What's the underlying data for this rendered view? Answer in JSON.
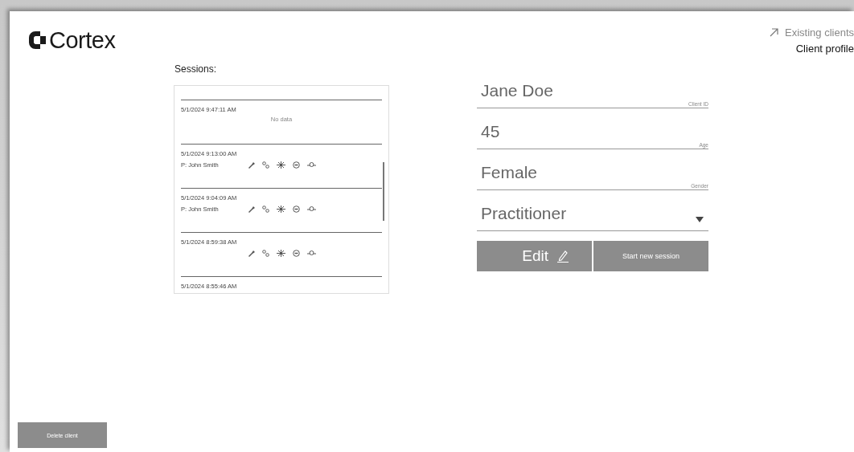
{
  "brand": {
    "name": "Cortex"
  },
  "nav": [
    {
      "label": "Existing clients",
      "selected": false
    },
    {
      "label": "Client profile",
      "selected": true
    }
  ],
  "sessions": {
    "title": "Sessions:",
    "items": [
      {
        "date": "5/1/2024 9:47:11 AM",
        "note": "No data",
        "has_metrics": false
      },
      {
        "date": "5/1/2024 9:13:00 AM",
        "practitioner": "P: John Smith",
        "has_metrics": true
      },
      {
        "date": "5/1/2024 9:04:09 AM",
        "practitioner": "P: John Smith",
        "has_metrics": true
      },
      {
        "date": "5/1/2024 8:59:38 AM",
        "has_metrics": true
      },
      {
        "date": "5/1/2024 8:55:46 AM"
      }
    ]
  },
  "fields": [
    {
      "value": "Jane Doe",
      "label": "Client ID"
    },
    {
      "value": "45",
      "label": "Age"
    },
    {
      "value": "Female",
      "label": "Gender"
    }
  ],
  "practitioner_select": {
    "placeholder": "Practitioner"
  },
  "buttons": {
    "edit": "Edit",
    "start": "Start new session",
    "delete": "Delete client"
  }
}
